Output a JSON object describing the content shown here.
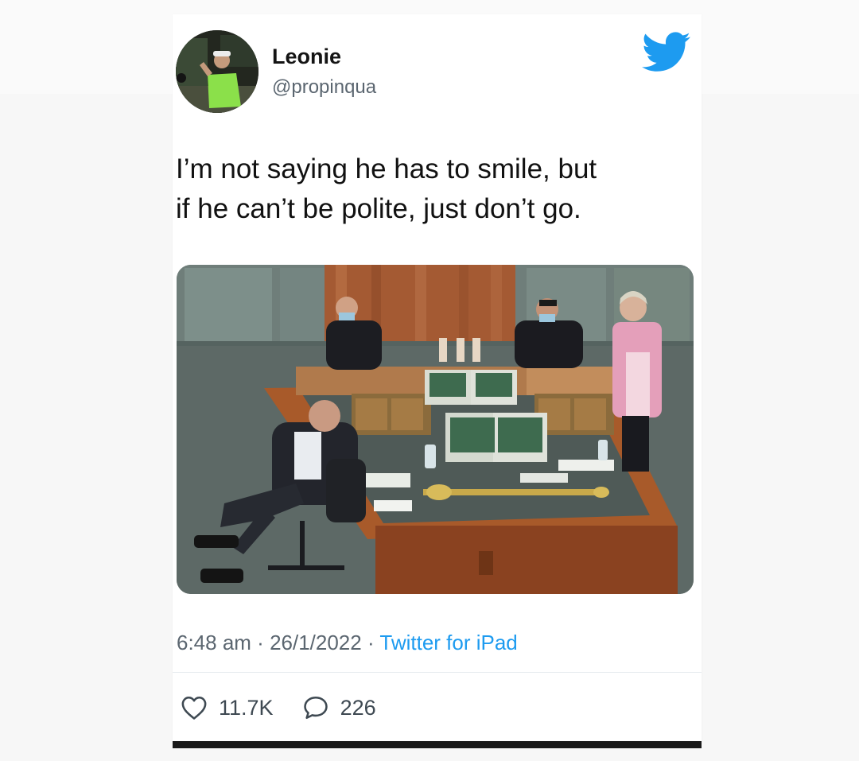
{
  "tweet": {
    "display_name": "Leonie",
    "handle": "@propinqua",
    "text_lines": [
      "I’m not saying he has to smile, but",
      "if he can’t be polite, just don’t go."
    ],
    "time": "6:48 am",
    "date": "26/1/2022",
    "separator": " · ",
    "source": "Twitter for iPad",
    "likes": "11.7K",
    "replies": "226"
  },
  "icons": {
    "brand": "twitter-bird-icon",
    "like": "heart-icon",
    "reply": "speech-bubble-icon"
  },
  "colors": {
    "brand_blue": "#1d9bf0",
    "text": "#111111",
    "secondary_text": "#5b6670"
  }
}
